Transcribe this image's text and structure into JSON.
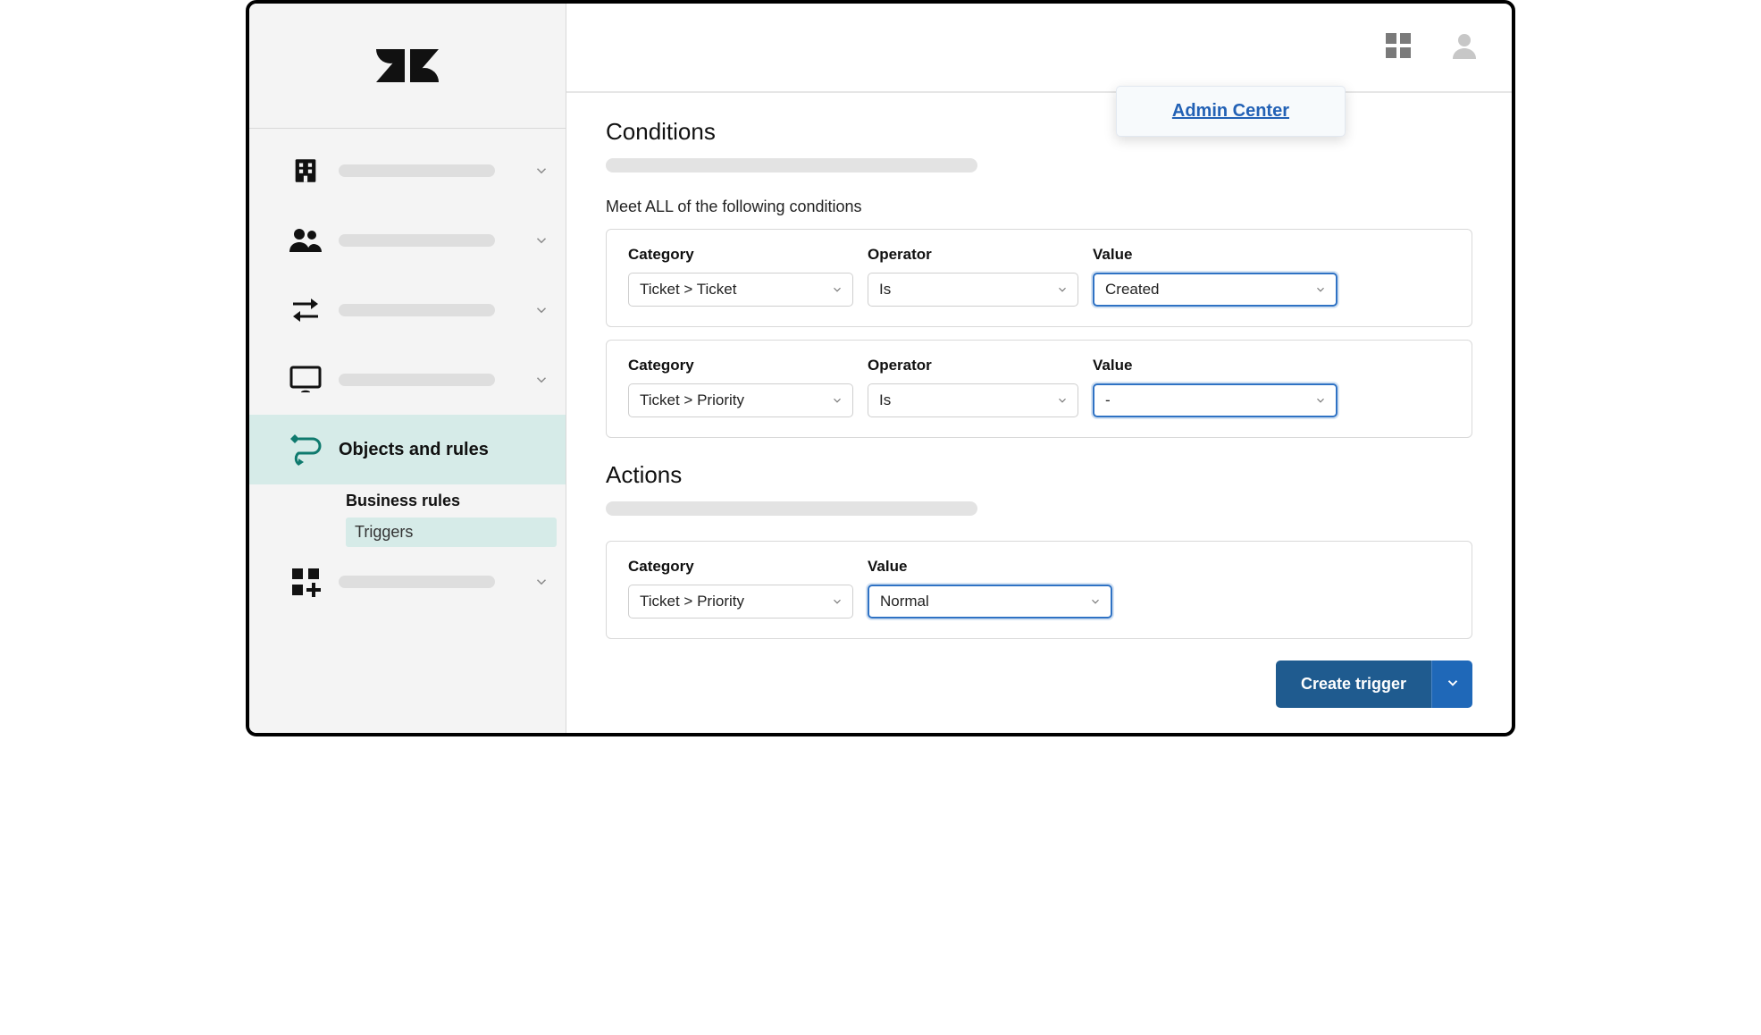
{
  "header": {
    "admin_popover_label": "Admin Center"
  },
  "sidebar": {
    "active_label": "Objects and rules",
    "sub_heading": "Business rules",
    "sub_item": "Triggers"
  },
  "conditions": {
    "title": "Conditions",
    "all_label": "Meet ALL of the following conditions",
    "labels": {
      "category": "Category",
      "operator": "Operator",
      "value": "Value"
    },
    "rows": [
      {
        "category": "Ticket > Ticket",
        "operator": "Is",
        "value": "Created"
      },
      {
        "category": "Ticket > Priority",
        "operator": "Is",
        "value": "-"
      }
    ]
  },
  "actions": {
    "title": "Actions",
    "labels": {
      "category": "Category",
      "value": "Value"
    },
    "rows": [
      {
        "category": "Ticket > Priority",
        "value": "Normal"
      }
    ]
  },
  "footer": {
    "create_button": "Create trigger"
  }
}
